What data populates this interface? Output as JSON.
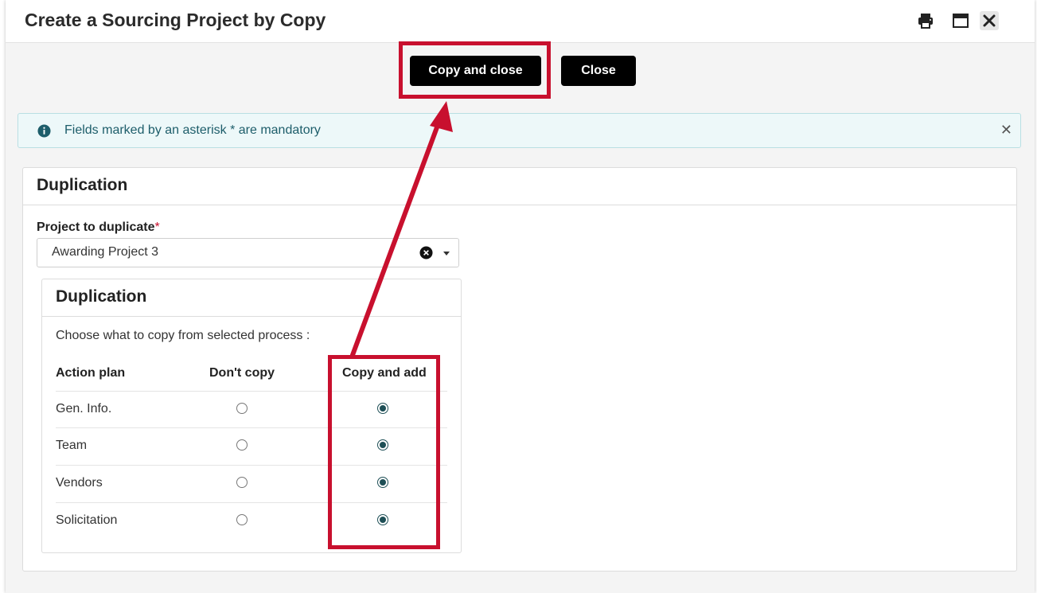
{
  "dialog": {
    "title": "Create a Sourcing Project by Copy",
    "icons": [
      "print-icon",
      "maximize-icon",
      "close-icon"
    ]
  },
  "toolbar": {
    "copy_and_close_label": "Copy and close",
    "close_label": "Close"
  },
  "info_banner": {
    "text": "Fields marked by an asterisk * are mandatory",
    "icon": "info-icon",
    "close_glyph": "✕"
  },
  "duplication_section": {
    "title": "Duplication",
    "project_field": {
      "label": "Project to duplicate",
      "required_marker": "*",
      "value": "Awarding Project 3"
    },
    "subsection": {
      "title": "Duplication",
      "instruction": "Choose what to copy from selected process :",
      "columns": [
        "Action plan",
        "Don't copy",
        "Copy and add"
      ],
      "rows": [
        {
          "label": "Gen. Info.",
          "selected": "Copy and add"
        },
        {
          "label": "Team",
          "selected": "Copy and add"
        },
        {
          "label": "Vendors",
          "selected": "Copy and add"
        },
        {
          "label": "Solicitation",
          "selected": "Copy and add"
        }
      ]
    }
  },
  "colors": {
    "annotation": "#c8102e",
    "button_bg": "#000000",
    "radio_checked": "#1e4f56",
    "info_bg": "#edf8f9",
    "info_text": "#1d5d6a"
  }
}
